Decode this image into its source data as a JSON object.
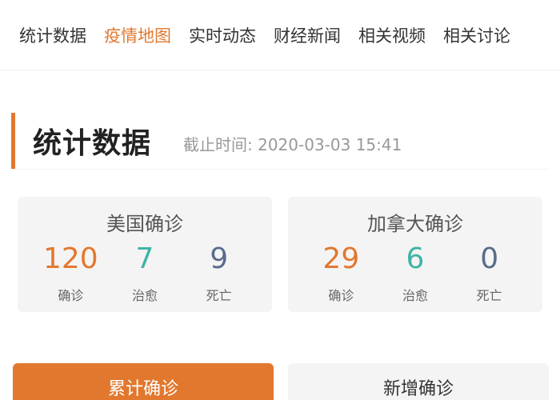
{
  "tabs": [
    {
      "label": "统计数据"
    },
    {
      "label": "疫情地图"
    },
    {
      "label": "实时动态"
    },
    {
      "label": "财经新闻"
    },
    {
      "label": "相关视频"
    },
    {
      "label": "相关讨论"
    }
  ],
  "active_tab_index": 1,
  "section": {
    "title": "统计数据",
    "time": "截止时间: 2020-03-03 15:41"
  },
  "cards": {
    "us": {
      "title": "美国确诊",
      "confirmed": "120",
      "confirmed_label": "确诊",
      "cured": "7",
      "cured_label": "治愈",
      "dead": "9",
      "dead_label": "死亡"
    },
    "ca": {
      "title": "加拿大确诊",
      "confirmed": "29",
      "confirmed_label": "确诊",
      "cured": "6",
      "cured_label": "治愈",
      "dead": "0",
      "dead_label": "死亡"
    }
  },
  "buttons": {
    "cumulative": "累计确诊",
    "new": "新增确诊"
  },
  "colors": {
    "accent": "#e2782e",
    "cured": "#3fb3a6",
    "dead": "#5a6b8c"
  }
}
